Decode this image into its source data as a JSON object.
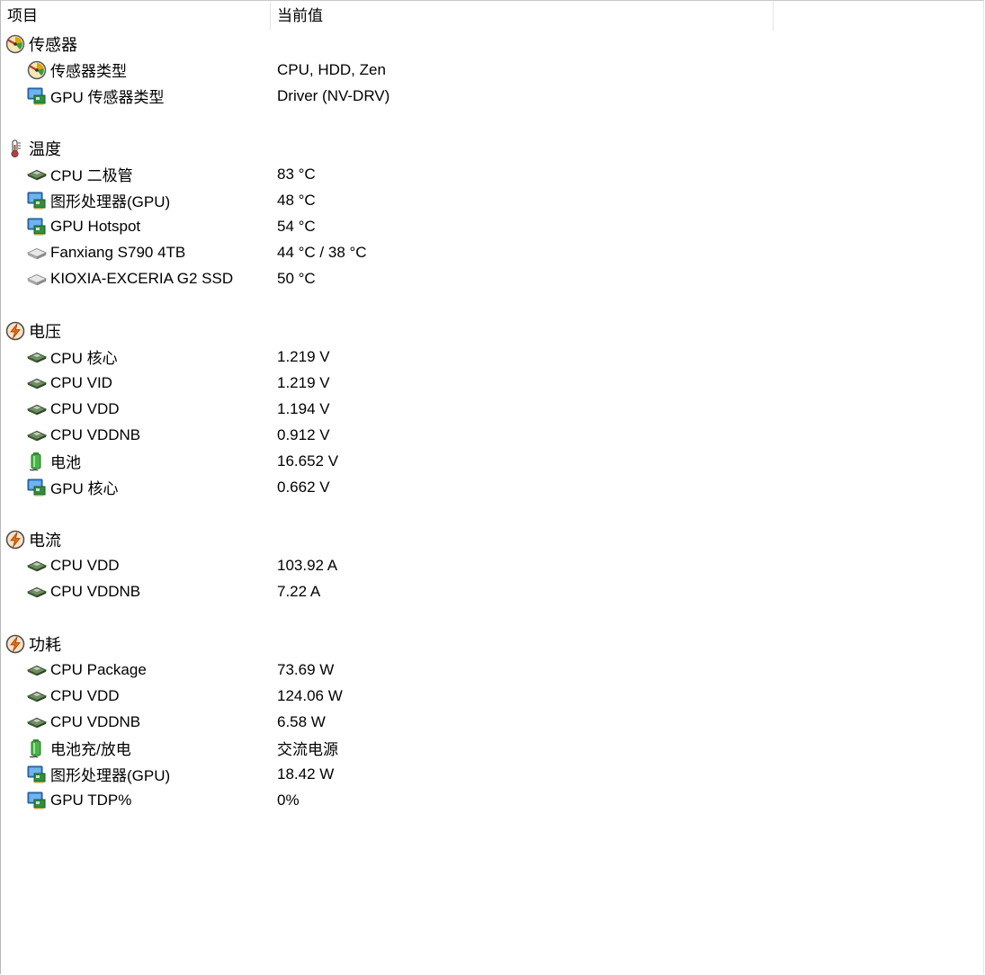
{
  "header": {
    "col_item": "项目",
    "col_value": "当前值"
  },
  "groups": [
    {
      "title": "传感器",
      "icon": "gauge-icon",
      "items": [
        {
          "label": "传感器类型",
          "value": "CPU, HDD, Zen",
          "icon": "gauge-icon"
        },
        {
          "label": "GPU 传感器类型",
          "value": "Driver  (NV-DRV)",
          "icon": "gpu-monitor-icon"
        }
      ]
    },
    {
      "title": "温度",
      "icon": "thermometer-icon",
      "items": [
        {
          "label": "CPU 二极管",
          "value": "83 °C",
          "icon": "cpu-chip-icon"
        },
        {
          "label": "图形处理器(GPU)",
          "value": "48 °C",
          "icon": "gpu-monitor-icon"
        },
        {
          "label": "GPU Hotspot",
          "value": "54 °C",
          "icon": "gpu-monitor-icon"
        },
        {
          "label": "Fanxiang S790 4TB",
          "value": "44 °C / 38 °C",
          "icon": "drive-icon"
        },
        {
          "label": "KIOXIA-EXCERIA G2 SSD",
          "value": "50 °C",
          "icon": "drive-icon"
        }
      ]
    },
    {
      "title": "电压",
      "icon": "lightning-icon",
      "items": [
        {
          "label": "CPU 核心",
          "value": "1.219 V",
          "icon": "cpu-chip-icon"
        },
        {
          "label": "CPU VID",
          "value": "1.219 V",
          "icon": "cpu-chip-icon"
        },
        {
          "label": "CPU VDD",
          "value": "1.194 V",
          "icon": "cpu-chip-icon"
        },
        {
          "label": "CPU VDDNB",
          "value": "0.912 V",
          "icon": "cpu-chip-icon"
        },
        {
          "label": "电池",
          "value": "16.652 V",
          "icon": "battery-icon"
        },
        {
          "label": "GPU 核心",
          "value": "0.662 V",
          "icon": "gpu-monitor-icon"
        }
      ]
    },
    {
      "title": "电流",
      "icon": "lightning-icon",
      "items": [
        {
          "label": "CPU VDD",
          "value": "103.92 A",
          "icon": "cpu-chip-icon"
        },
        {
          "label": "CPU VDDNB",
          "value": "7.22 A",
          "icon": "cpu-chip-icon"
        }
      ]
    },
    {
      "title": "功耗",
      "icon": "lightning-icon",
      "items": [
        {
          "label": "CPU Package",
          "value": "73.69 W",
          "icon": "cpu-chip-icon"
        },
        {
          "label": "CPU VDD",
          "value": "124.06 W",
          "icon": "cpu-chip-icon"
        },
        {
          "label": "CPU VDDNB",
          "value": "6.58 W",
          "icon": "cpu-chip-icon"
        },
        {
          "label": "电池充/放电",
          "value": "交流电源",
          "icon": "battery-icon"
        },
        {
          "label": "图形处理器(GPU)",
          "value": "18.42 W",
          "icon": "gpu-monitor-icon"
        },
        {
          "label": "GPU TDP%",
          "value": "0%",
          "icon": "gpu-monitor-icon"
        }
      ]
    }
  ]
}
